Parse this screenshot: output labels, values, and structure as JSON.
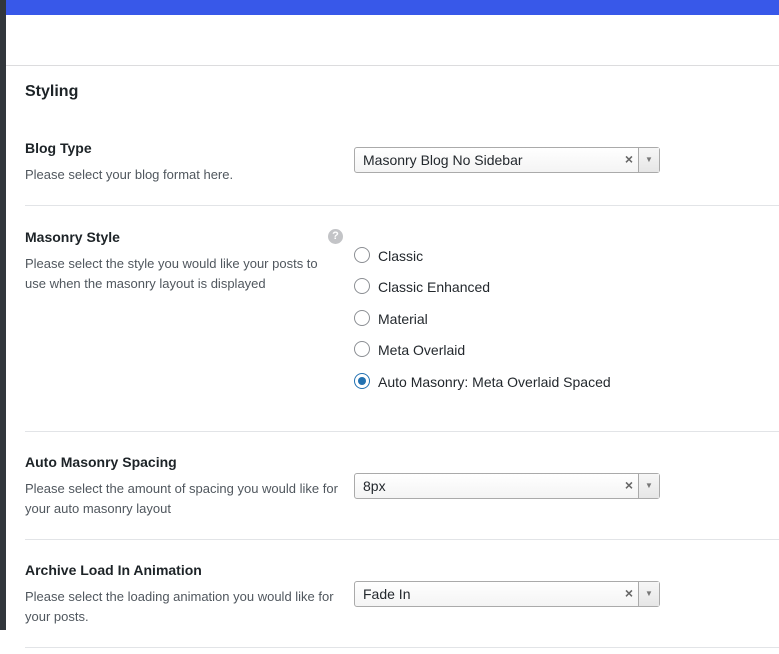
{
  "colors": {
    "top_bar": "#3858e9",
    "radio_checked": "#2271b1"
  },
  "section": {
    "title": "Styling"
  },
  "blog_type": {
    "label": "Blog Type",
    "description": "Please select your blog format here.",
    "selected": "Masonry Blog No Sidebar",
    "clear_icon": "×",
    "arrow_icon": "▼"
  },
  "masonry_style": {
    "label": "Masonry Style",
    "description": "Please select the style you would like your posts to use when the masonry layout is displayed",
    "help_icon": "?",
    "options": [
      {
        "label": "Classic",
        "checked": false
      },
      {
        "label": "Classic Enhanced",
        "checked": false
      },
      {
        "label": "Material",
        "checked": false
      },
      {
        "label": "Meta Overlaid",
        "checked": false
      },
      {
        "label": "Auto Masonry: Meta Overlaid Spaced",
        "checked": true
      }
    ]
  },
  "auto_masonry_spacing": {
    "label": "Auto Masonry Spacing",
    "description": "Please select the amount of spacing you would like for your auto masonry layout",
    "selected": "8px",
    "clear_icon": "×",
    "arrow_icon": "▼"
  },
  "archive_animation": {
    "label": "Archive Load In Animation",
    "description": "Please select the loading animation you would like for your posts.",
    "selected": "Fade In",
    "clear_icon": "×",
    "arrow_icon": "▼"
  }
}
